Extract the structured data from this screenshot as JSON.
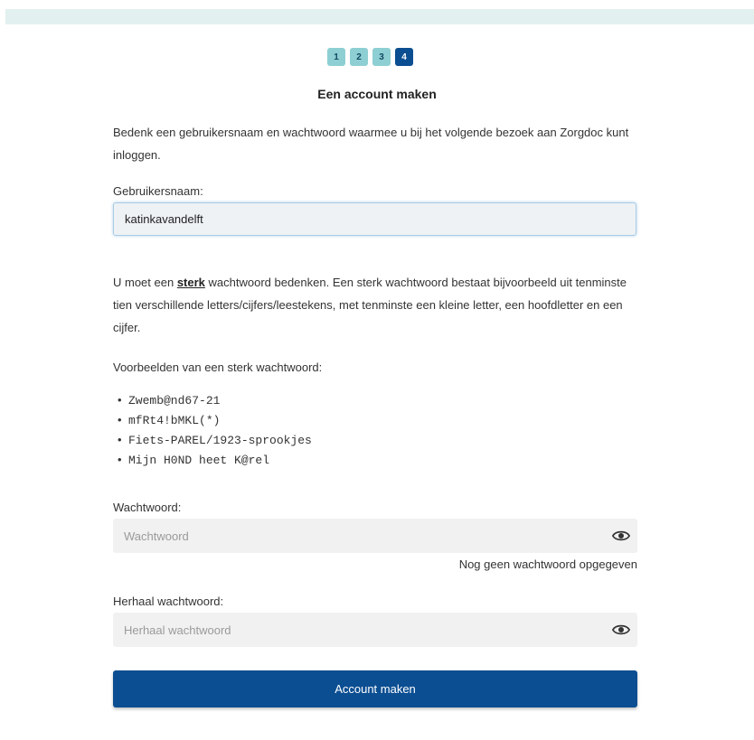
{
  "steps": [
    "1",
    "2",
    "3",
    "4"
  ],
  "active_step": "4",
  "title": "Een account maken",
  "intro": "Bedenk een gebruikersnaam en wachtwoord waarmee u bij het volgende bezoek aan Zorgdoc kunt inloggen.",
  "username": {
    "label": "Gebruikersnaam:",
    "value": "katinkavandelft"
  },
  "password_info": {
    "before": "U moet een ",
    "link": "sterk",
    "after": " wachtwoord bedenken. Een sterk wachtwoord bestaat bijvoorbeeld uit tenminste tien verschillende letters/cijfers/leestekens, met tenminste een kleine letter, een hoofdletter en een cijfer."
  },
  "examples_title": "Voorbeelden van een sterk wachtwoord:",
  "examples": [
    "Zwemb@nd67-21",
    "mfRt4!bMKL(*)",
    "Fiets-PAREL/1923-sprookjes",
    "Mijn H0ND heet K@rel"
  ],
  "password": {
    "label": "Wachtwoord:",
    "placeholder": "Wachtwoord",
    "status": "Nog geen wachtwoord opgegeven",
    "toggle_icon": "eye-icon"
  },
  "repeat_password": {
    "label": "Herhaal wachtwoord:",
    "placeholder": "Herhaal wachtwoord",
    "toggle_icon": "eye-icon"
  },
  "submit_label": "Account maken",
  "colors": {
    "primary": "#0b4e92",
    "step_inactive": "#8ecfd3",
    "top_bar": "#e3f0f0"
  }
}
